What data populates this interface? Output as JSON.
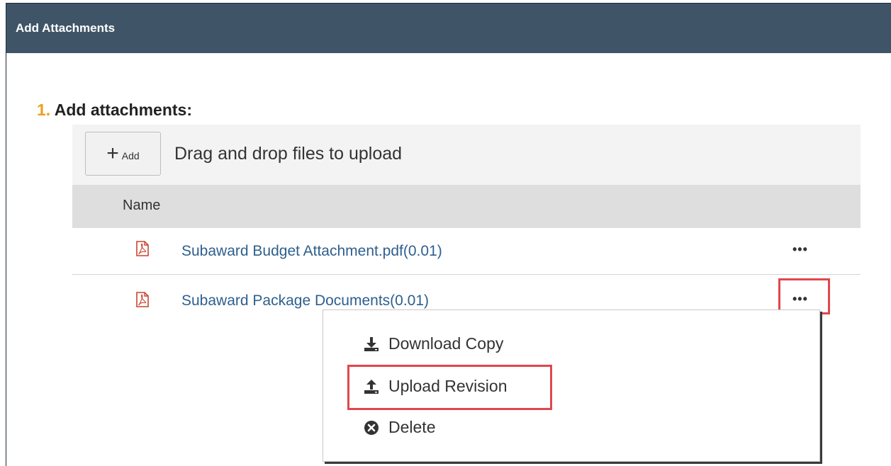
{
  "dialog": {
    "title": "Add Attachments"
  },
  "section": {
    "number": "1.",
    "label": "Add attachments:"
  },
  "toolbar": {
    "add_plus": "+",
    "add_label": "Add",
    "drop_text": "Drag and drop files to upload"
  },
  "table": {
    "column_name": "Name",
    "rows": [
      {
        "name": "Subaward Budget Attachment.pdf(0.01)",
        "icon": "pdf-icon",
        "more": "•••"
      },
      {
        "name": "Subaward Package Documents(0.01)",
        "icon": "pdf-icon",
        "more": "•••"
      }
    ]
  },
  "menu": {
    "items": [
      {
        "label": "Download Copy",
        "icon": "download-icon"
      },
      {
        "label": "Upload Revision",
        "icon": "upload-icon"
      },
      {
        "label": "Delete",
        "icon": "delete-icon"
      }
    ]
  },
  "colors": {
    "titlebar": "#3f5567",
    "accent_number": "#e8a020",
    "link": "#2e5f8e",
    "highlight": "#e0474c"
  }
}
